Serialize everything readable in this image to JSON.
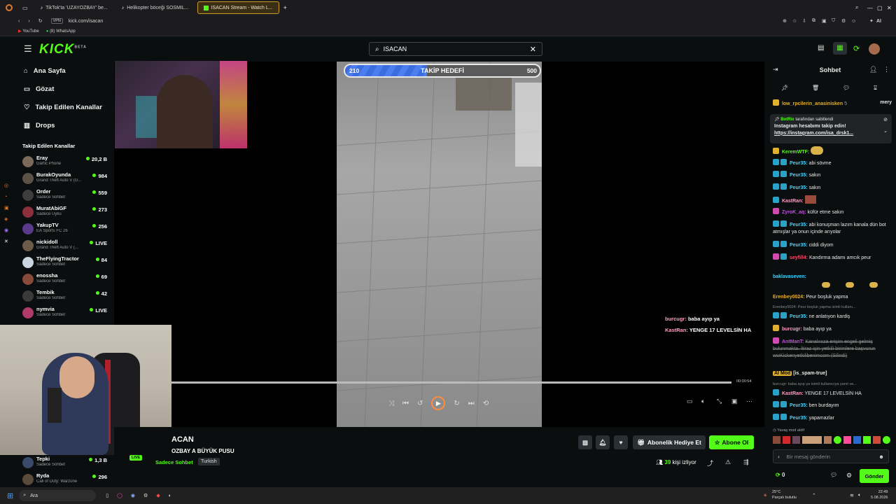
{
  "browser": {
    "tabs": [
      {
        "label": "TikTok'ta 'UZAYOZBAY' be..."
      },
      {
        "label": "Helikopter böceği SOSMIL..."
      },
      {
        "label": "ISACAN Stream - Watch L..."
      }
    ],
    "url": "kick.com/isacan",
    "vpn": "VPN",
    "bookmarks": [
      "YouTube",
      "(8) WhatsApp"
    ],
    "ai_label": "AI"
  },
  "header": {
    "logo": "KICK",
    "logo_sup": "BETA",
    "search_value": "ISACAN"
  },
  "sidebar": {
    "nav": [
      {
        "label": "Ana Sayfa"
      },
      {
        "label": "Gözat"
      },
      {
        "label": "Takip Edilen Kanallar"
      },
      {
        "label": "Drops"
      }
    ],
    "section_title": "Takip Edilen Kanallar",
    "channels": [
      {
        "name": "Eray",
        "game": "Gartic Phone",
        "viewers": "20,2 B"
      },
      {
        "name": "BurakOyunda",
        "game": "Grand Theft Auto V (G...",
        "viewers": "984"
      },
      {
        "name": "Order",
        "game": "Sadece Sohbet",
        "viewers": "559"
      },
      {
        "name": "MuratAbiGF",
        "game": "Sadece Uyku",
        "viewers": "273"
      },
      {
        "name": "YakupTV",
        "game": "EA Sports FC 26",
        "viewers": "256"
      },
      {
        "name": "nickidoll",
        "game": "Grand Theft Auto V (...",
        "viewers": "LIVE"
      },
      {
        "name": "TheFlyingTractor",
        "game": "Sadece Sohbet",
        "viewers": "84"
      },
      {
        "name": "enossha",
        "game": "Sadece Sohbet",
        "viewers": "69"
      },
      {
        "name": "Tembik",
        "game": "Sadece Sohbet",
        "viewers": "42"
      },
      {
        "name": "nymvia",
        "game": "Sadece Sohbet",
        "viewers": "LIVE"
      },
      {
        "name": "Tepki",
        "game": "Sadece Sohbet",
        "viewers": "1,3 B"
      },
      {
        "name": "Ryda",
        "game": "Call of Duty: Warzone",
        "viewers": "296"
      }
    ]
  },
  "video": {
    "goal_label": "TAKİP HEDEFİ",
    "goal_current": "210",
    "goal_target": "500",
    "goal_fraction": 0.42,
    "overlay_lines": [
      {
        "user": "burcugr:",
        "text": "baba ayıp ya"
      },
      {
        "user": "KastRan:",
        "text": "YENGE 17 LEVELSİN HA"
      }
    ],
    "time": "00:00:54"
  },
  "stream_info": {
    "channel": "ACAN",
    "title": "OZBAY A BÜYÜK PUSU",
    "live_badge": "LIVE",
    "category": "Sadece Sohbet",
    "tag": "Turkish",
    "gift_sub": "Abonelik Hediye Et",
    "subscribe": "Abone Ol",
    "viewers_count": "39",
    "viewers_label": "kişi izliyor"
  },
  "chat": {
    "title": "Sohbet",
    "pinned_by": "BotRix",
    "pinned_suffix": "tarafından sabitlendi",
    "pinned_text": "Instagram hesabımı takip edin!",
    "pinned_link": "https://instagram.com/isa_drsk1...",
    "top_line": {
      "user": "low_rpcilerin_anasinisken",
      "count": "5",
      "extra": "mery"
    },
    "messages": [
      {
        "user": "KeremWTF:",
        "text": ""
      },
      {
        "user": "Peur35:",
        "text": "abi sövme"
      },
      {
        "user": "Peur35:",
        "text": "sakın"
      },
      {
        "user": "Peur35:",
        "text": "sakın"
      },
      {
        "user": "KastRan:",
        "text": ""
      },
      {
        "user": "ZyroK_aq:",
        "text": "küfür etme sakın"
      },
      {
        "user": "Peur35:",
        "text": "abi konuşman lazım kanala dün bot atmışlar ya onun içinde arıyolar"
      },
      {
        "user": "Peur35:",
        "text": "ciddi diyom"
      },
      {
        "user": "seyfill4:",
        "text": "Kandırma adamı amcık peur"
      },
      {
        "user": "baklavaseven:",
        "text": ""
      },
      {
        "user": "Erenbey0024:",
        "text": "Peur boşluk yapma"
      },
      {
        "user": "Peur35:",
        "text": "ne anlatıyon kardiş"
      },
      {
        "user": "burcugr:",
        "text": "baba ayıp ya"
      },
      {
        "user": "AntManT:",
        "text": "Kanalınıza erişim engeli gelmiş bulunmakta. İtiraz için yetkili birimlere başvurun wwKickenyetkilibenimcom (Silindi)"
      },
      {
        "user": "AI Mod",
        "text": "[is_spam-true]"
      },
      {
        "user": "KastRan:",
        "text": "YENGE 17 LEVELSİN HA"
      },
      {
        "user": "Peur35:",
        "text": "ben burdayım"
      },
      {
        "user": "Peur35:",
        "text": "yapamazlar"
      }
    ],
    "reply_1": "Erenbey0024: Peur boşluk yapma isimli kullanı...",
    "reply_2": "burcugr: baba ayıp ya isimli kullanıcıya yanıt ve...",
    "slow_mode": "Yavaş mod aktif",
    "input_placeholder": "Bir mesaj gönderin",
    "points": "0",
    "send": "Gönder"
  },
  "taskbar": {
    "search_placeholder": "Ara",
    "weather_temp": "25°C",
    "weather_desc": "Parçalı bulutlu",
    "time": "22:49",
    "date": "5.08.2026"
  },
  "colors": {
    "kick_green": "#53fc18",
    "goal_blue": "#4d7ef0",
    "play_ring": "#ff8c42"
  }
}
